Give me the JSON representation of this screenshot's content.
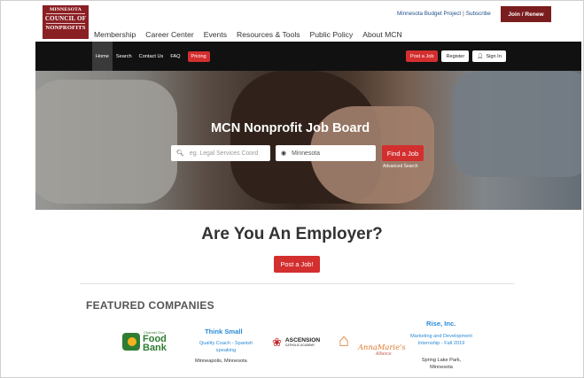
{
  "header": {
    "logo": [
      "MINNESOTA",
      "COUNCIL OF",
      "NONPROFITS"
    ],
    "top_links": [
      "Minnesota Budget Project",
      "Subscribe"
    ],
    "join_label": "Join / Renew",
    "main_nav": [
      "Membership",
      "Career Center",
      "Events",
      "Resources & Tools",
      "Public Policy",
      "About MCN"
    ]
  },
  "subnav": {
    "items": [
      "Home",
      "Search",
      "Contact Us",
      "FAQ"
    ],
    "pricing": "Pricing",
    "post_job": "Post a Job",
    "register": "Register",
    "sign_in": "Sign In"
  },
  "hero": {
    "title": "MCN Nonprofit Job Board",
    "search_placeholder": "eg. Legal Services Coord",
    "location_value": "Minnesota",
    "find_label": "Find a Job",
    "advanced": "Advanced Search"
  },
  "employer": {
    "title": "Are You An Employer?",
    "post_label": "Post a Job!"
  },
  "featured": {
    "title": "FEATURED COMPANIES",
    "food_bank": {
      "line1": "Channel One",
      "line2": "Food",
      "line3": "Bank"
    },
    "think_small": {
      "name": "Think Small",
      "job": "Quality Coach - Spanish speaking",
      "location": "Minneapolis, Minnesota"
    },
    "ascension": {
      "name": "ASCENSION",
      "sub": "CATHOLIC ACADEMY"
    },
    "annamarie": {
      "name": "AnnaMarie's",
      "sub": "Alliance"
    },
    "rise": {
      "name": "Rise, Inc.",
      "job": "Marketing and Development Internship - Fall 2019",
      "location": "Spring Lake Park, Minnesota"
    }
  },
  "colors": {
    "brand": "#8a1f24",
    "accent": "#d32f2f",
    "link": "#2a8ad6"
  }
}
